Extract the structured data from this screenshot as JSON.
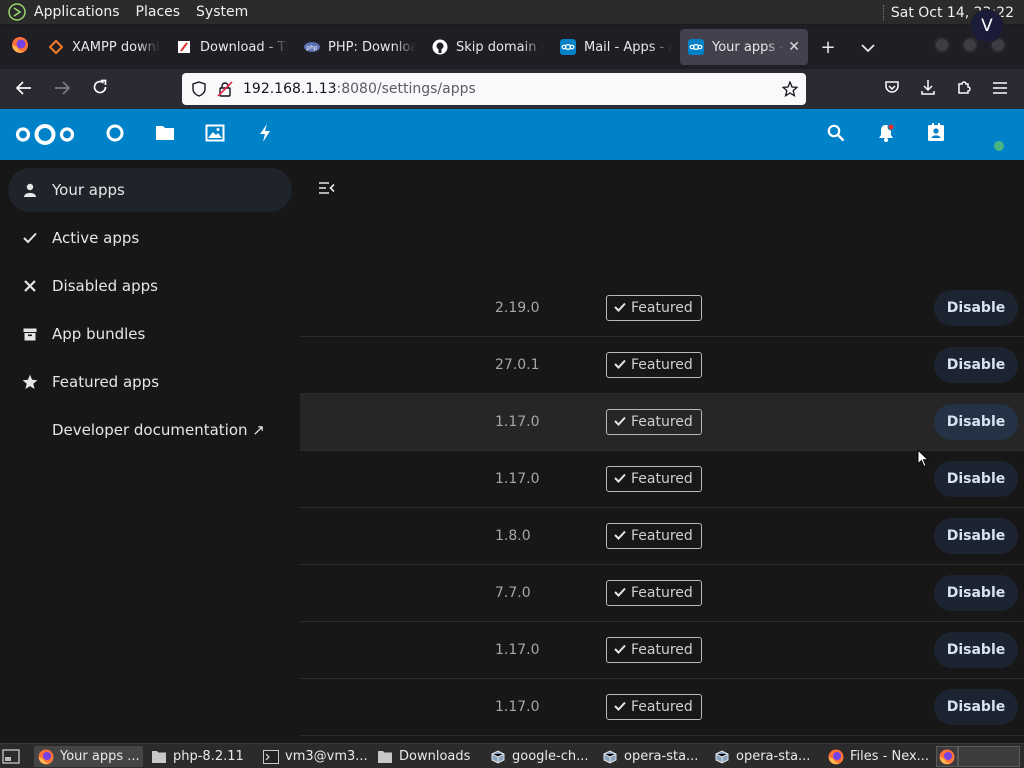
{
  "top_panel": {
    "menus": [
      "Applications",
      "Places",
      "System"
    ],
    "clock": "Sat Oct 14, 23:22"
  },
  "tabs": [
    {
      "label": "XAMPP downloads",
      "icon": "xampp-favicon"
    },
    {
      "label": "Download - The",
      "icon": "download-favicon"
    },
    {
      "label": "PHP: Downloads",
      "icon": "php-favicon"
    },
    {
      "label": "Skip domain v",
      "icon": "github-favicon"
    },
    {
      "label": "Mail - Apps - A",
      "icon": "nextcloud-favicon"
    },
    {
      "label": "Your apps -",
      "icon": "nextcloud-favicon",
      "active": true
    }
  ],
  "url_bar": {
    "host": "192.168.1.13",
    "path": ":8080/settings/apps"
  },
  "sidebar": {
    "items": [
      {
        "label": "Your apps",
        "icon": "user-icon",
        "active": true
      },
      {
        "label": "Active apps",
        "icon": "check-icon"
      },
      {
        "label": "Disabled apps",
        "icon": "x-icon"
      },
      {
        "label": "App bundles",
        "icon": "archive-icon"
      },
      {
        "label": "Featured apps",
        "icon": "star-icon"
      },
      {
        "label": "Developer documentation ↗",
        "icon": ""
      }
    ]
  },
  "apps": [
    {
      "version": "2.19.0",
      "badge": "Featured",
      "action": "Disable"
    },
    {
      "version": "27.0.1",
      "badge": "Featured",
      "action": "Disable"
    },
    {
      "version": "1.17.0",
      "badge": "Featured",
      "action": "Disable",
      "hovered": true
    },
    {
      "version": "1.17.0",
      "badge": "Featured",
      "action": "Disable"
    },
    {
      "version": "1.8.0",
      "badge": "Featured",
      "action": "Disable"
    },
    {
      "version": "7.7.0",
      "badge": "Featured",
      "action": "Disable"
    },
    {
      "version": "1.17.0",
      "badge": "Featured",
      "action": "Disable"
    },
    {
      "version": "1.17.0",
      "badge": "Featured",
      "action": "Disable"
    }
  ],
  "taskbar": {
    "tasks": [
      {
        "label": "Your apps ...",
        "icon": "firefox-icon",
        "active": true
      },
      {
        "label": "php-8.2.11",
        "icon": "folder-icon"
      },
      {
        "label": "vm3@vm3...",
        "icon": "terminal-icon"
      },
      {
        "label": "Downloads",
        "icon": "folder-icon"
      },
      {
        "label": "google-ch...",
        "icon": "package-icon"
      },
      {
        "label": "opera-sta...",
        "icon": "package-icon"
      },
      {
        "label": "opera-sta...",
        "icon": "package-icon"
      },
      {
        "label": "Files - Nex...",
        "icon": "firefox-icon"
      }
    ]
  },
  "colors": {
    "nextcloud_blue": "#0082c9",
    "background": "#171717",
    "primary_button": "#1c2431"
  }
}
